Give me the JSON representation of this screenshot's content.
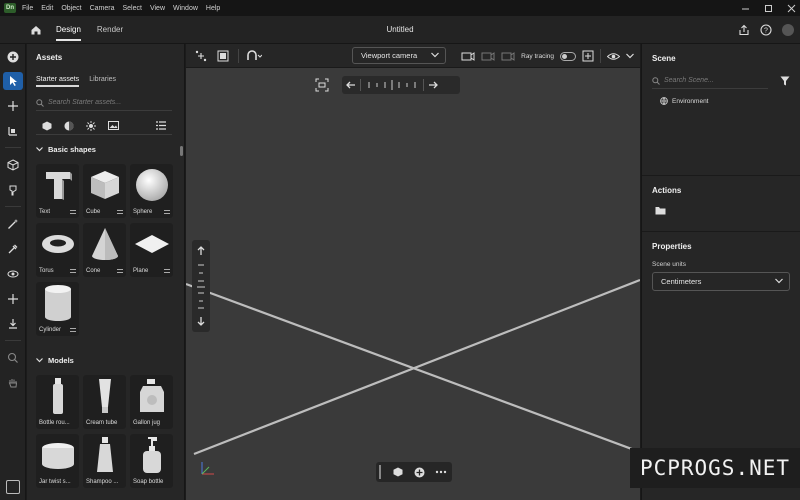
{
  "menubar": {
    "logo": "Dn",
    "items": [
      "File",
      "Edit",
      "Object",
      "Camera",
      "Select",
      "View",
      "Window",
      "Help"
    ]
  },
  "topbar": {
    "tabs": [
      {
        "label": "Design",
        "active": true
      },
      {
        "label": "Render",
        "active": false
      }
    ],
    "document_title": "Untitled"
  },
  "assets": {
    "title": "Assets",
    "tabs": [
      {
        "label": "Starter assets",
        "active": true
      },
      {
        "label": "Libraries",
        "active": false
      }
    ],
    "search_placeholder": "Search Starter assets...",
    "sections": [
      {
        "title": "Basic shapes",
        "items": [
          "Text",
          "Cube",
          "Sphere",
          "Torus",
          "Cone",
          "Plane",
          "Cylinder"
        ]
      },
      {
        "title": "Models",
        "items": [
          "Bottle rou...",
          "Cream tube",
          "Gallon jug",
          "Jar twist s...",
          "Shampoo ...",
          "Soap bottle"
        ]
      }
    ]
  },
  "viewport": {
    "camera_select": "Viewport camera",
    "ray_tracing_label": "Ray tracing",
    "ray_tracing_on": false
  },
  "right_panel": {
    "scene_title": "Scene",
    "scene_search_placeholder": "Search Scene...",
    "scene_items": [
      "Environment"
    ],
    "actions_title": "Actions",
    "properties_title": "Properties",
    "scene_units_label": "Scene units",
    "scene_units_value": "Centimeters"
  },
  "watermark": "PCPROGS.NET",
  "colors": {
    "accent": "#1f5fa8",
    "viewport_bg": "#3a3a3a",
    "panel_bg": "#262626"
  }
}
